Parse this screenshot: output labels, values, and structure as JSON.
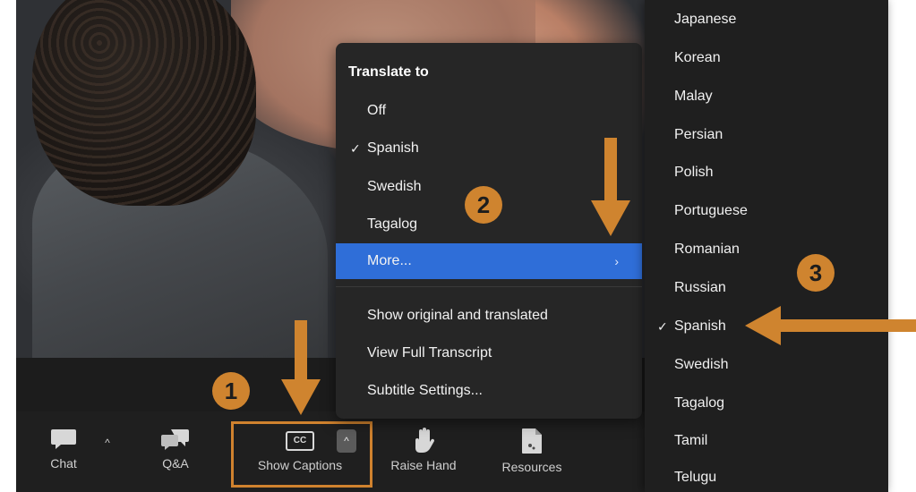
{
  "colors": {
    "accent": "#cf842f",
    "menu_selected": "#2f6ed8",
    "menu_bg": "#262626",
    "toolbar_bg": "#1f1f1f"
  },
  "menu_translate": {
    "heading": "Translate to",
    "items": [
      {
        "label": "Off",
        "checked": false
      },
      {
        "label": "Spanish",
        "checked": true
      },
      {
        "label": "Swedish",
        "checked": false
      },
      {
        "label": "Tagalog",
        "checked": false
      },
      {
        "label": "More...",
        "selected": true,
        "has_submenu": true
      }
    ],
    "options": [
      {
        "label": "Show original and translated"
      },
      {
        "label": "View Full Transcript"
      },
      {
        "label": "Subtitle Settings..."
      }
    ],
    "submenu_arrow_icon": "chevron-right-icon",
    "check_mark": "✓"
  },
  "submenu_languages": {
    "items": [
      {
        "label": "Japanese"
      },
      {
        "label": "Korean"
      },
      {
        "label": "Malay"
      },
      {
        "label": "Persian"
      },
      {
        "label": "Polish"
      },
      {
        "label": "Portuguese"
      },
      {
        "label": "Romanian"
      },
      {
        "label": "Russian"
      },
      {
        "label": "Spanish",
        "checked": true
      },
      {
        "label": "Swedish"
      },
      {
        "label": "Tagalog"
      },
      {
        "label": "Tamil"
      },
      {
        "label": "Telugu"
      }
    ],
    "check_mark": "✓"
  },
  "toolbar": {
    "chat": {
      "label": "Chat",
      "icon": "chat-icon"
    },
    "qa": {
      "label": "Q&A",
      "icon": "qa-icon"
    },
    "captions": {
      "label": "Show Captions",
      "icon": "cc-icon",
      "icon_text": "CC"
    },
    "raise_hand": {
      "label": "Raise Hand",
      "icon": "hand-icon"
    },
    "resources": {
      "label": "Resources",
      "icon": "document-icon"
    }
  },
  "annotations": {
    "step1": "1",
    "step2": "2",
    "step3": "3"
  }
}
